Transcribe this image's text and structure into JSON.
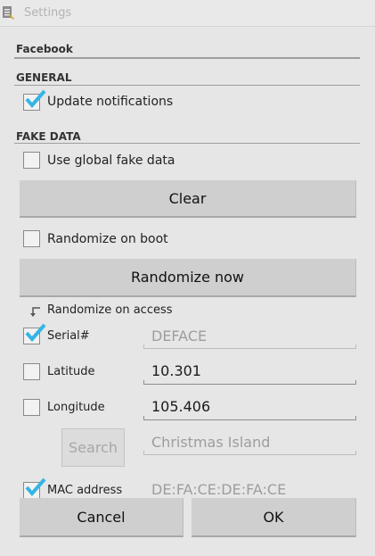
{
  "window": {
    "title": "Settings"
  },
  "app": {
    "name": "Facebook"
  },
  "sections": {
    "general": "GENERAL",
    "fake_data": "FAKE DATA"
  },
  "general": {
    "update_notifications": {
      "label": "Update notifications",
      "checked": true
    }
  },
  "fake_data": {
    "use_global": {
      "label": "Use global fake data",
      "checked": false
    },
    "clear_button": "Clear",
    "randomize_on_boot": {
      "label": "Randomize on boot",
      "checked": false
    },
    "randomize_now_button": "Randomize now",
    "randomize_on_access": {
      "label": "Randomize on access"
    },
    "fields": [
      {
        "label": "Serial#",
        "checked": true,
        "value": "DEFACE",
        "enabled": false
      },
      {
        "label": "Latitude",
        "checked": false,
        "value": "10.301",
        "enabled": true
      },
      {
        "label": "Longitude",
        "checked": false,
        "value": "105.406",
        "enabled": true
      },
      {
        "label": "MAC address",
        "checked": true,
        "value": "DE:FA:CE:DE:FA:CE",
        "enabled": false
      }
    ],
    "search": {
      "button": "Search",
      "value": "Christmas Island"
    }
  },
  "dialog_buttons": {
    "cancel": "Cancel",
    "ok": "OK"
  },
  "colors": {
    "accent_check": "#33b5e5",
    "background": "#e6e6e6",
    "button": "#cfcfcf"
  }
}
